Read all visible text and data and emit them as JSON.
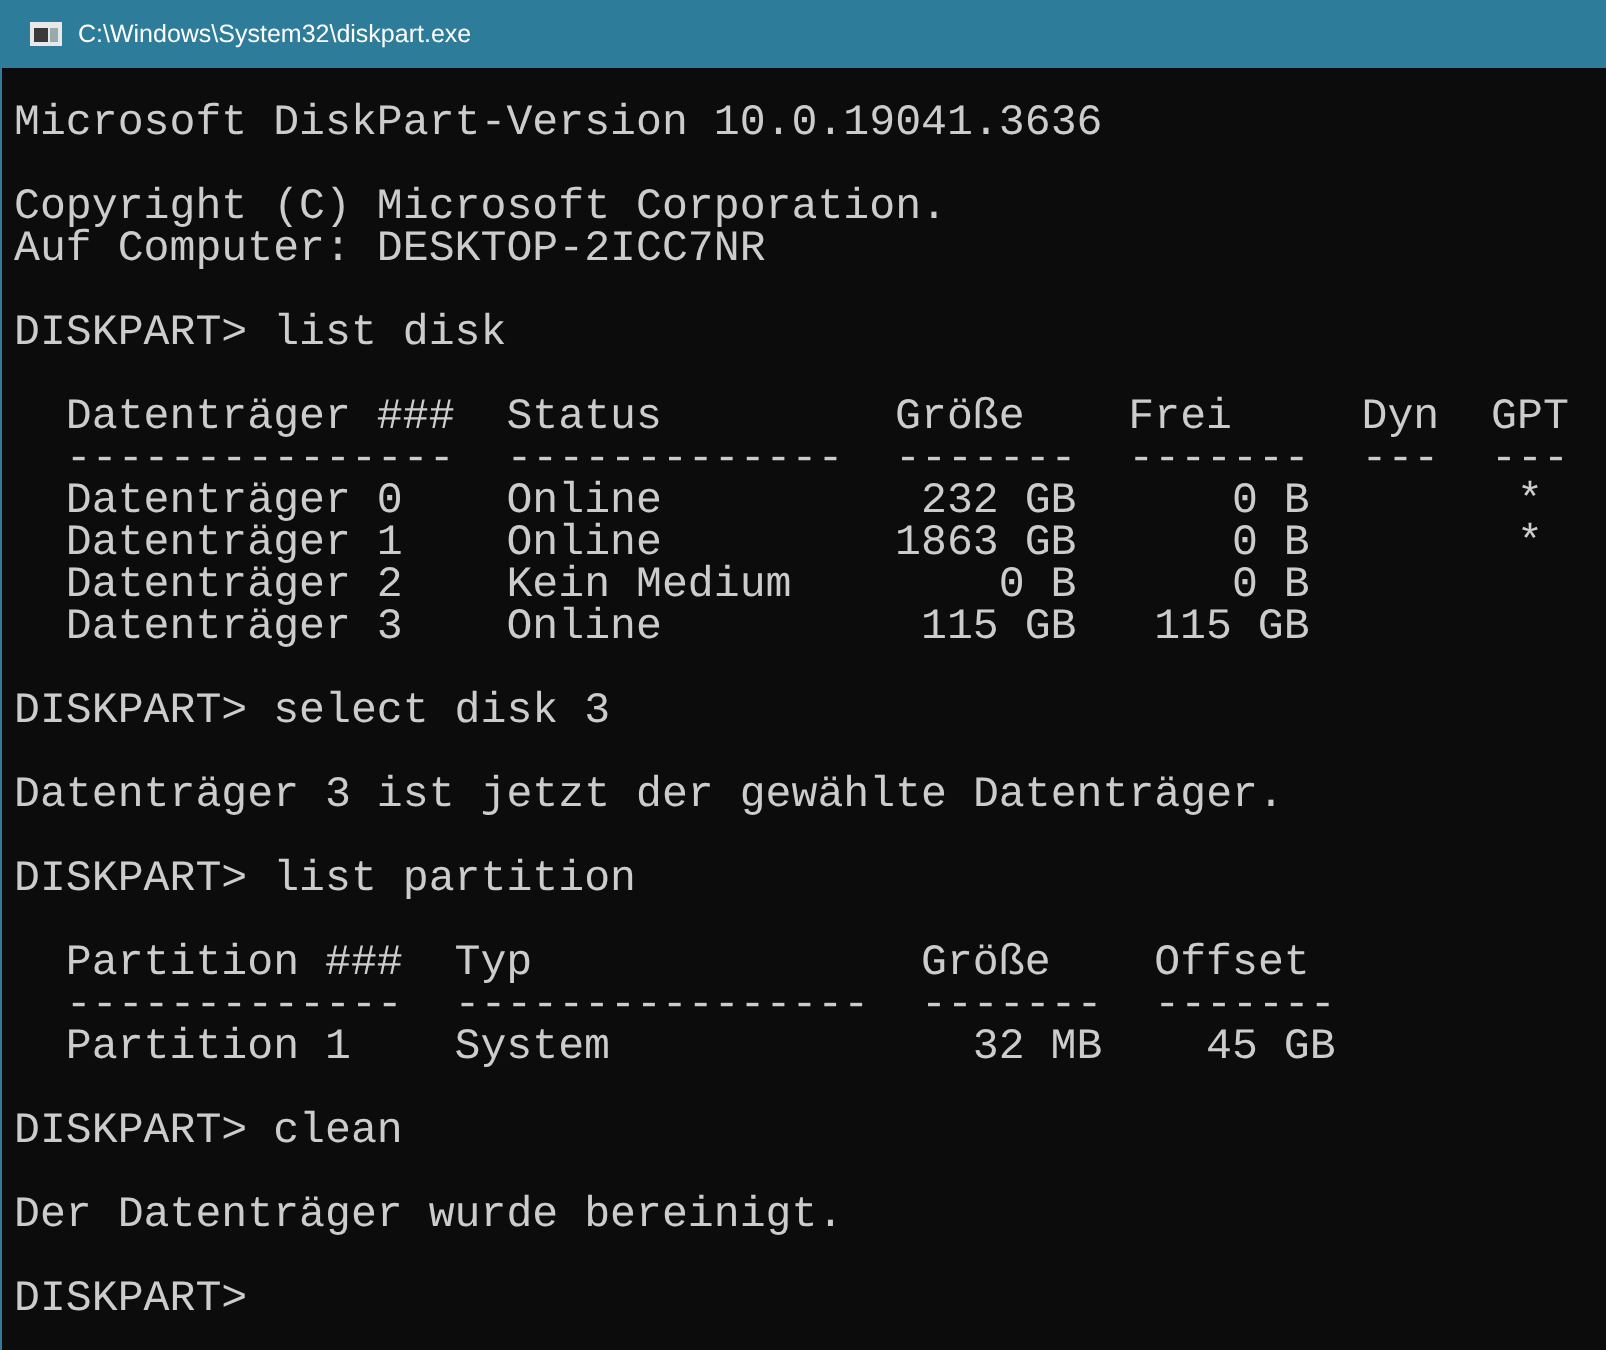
{
  "window": {
    "title": "C:\\Windows\\System32\\diskpart.exe"
  },
  "blocks": [
    {
      "kind": "lines",
      "lines": [
        "Microsoft DiskPart-Version 10.0.19041.3636"
      ]
    },
    {
      "kind": "lines",
      "lines": [
        "Copyright (C) Microsoft Corporation.",
        "Auf Computer: DESKTOP-2ICC7NR"
      ]
    },
    {
      "kind": "lines",
      "lines": [
        "DISKPART> list disk"
      ]
    },
    {
      "kind": "table",
      "columns": [
        {
          "header": "Datenträger ###",
          "rule": "---------------",
          "kind": "text"
        },
        {
          "header": "Status",
          "rule": "-------------",
          "kind": "text"
        },
        {
          "header": "Größe",
          "rule": "-------",
          "kind": "size"
        },
        {
          "header": "Frei",
          "rule": "-------",
          "kind": "size"
        },
        {
          "header": "Dyn",
          "rule": "---"
        },
        {
          "header": "GPT",
          "rule": "---",
          "kind": "flag"
        }
      ],
      "rows": [
        [
          "Datenträger 0",
          "Online",
          "232 GB",
          "0 B",
          null,
          "*"
        ],
        [
          "Datenträger 1",
          "Online",
          "1863 GB",
          "0 B",
          null,
          "*"
        ],
        [
          "Datenträger 2",
          "Kein Medium",
          "0 B",
          "0 B",
          null,
          null
        ],
        [
          "Datenträger 3",
          "Online",
          "115 GB",
          "115 GB",
          null,
          null
        ]
      ]
    },
    {
      "kind": "lines",
      "lines": [
        "DISKPART> select disk 3"
      ]
    },
    {
      "kind": "lines",
      "lines": [
        "Datenträger 3 ist jetzt der gewählte Datenträger."
      ]
    },
    {
      "kind": "lines",
      "lines": [
        "DISKPART> list partition"
      ]
    },
    {
      "kind": "table",
      "columns": [
        {
          "header": "Partition ###",
          "rule": "-------------",
          "kind": "text"
        },
        {
          "header": "Typ",
          "rule": "----------------",
          "kind": "text"
        },
        {
          "header": "Größe",
          "rule": "-------",
          "kind": "size"
        },
        {
          "header": "Offset",
          "rule": "-------",
          "kind": "size"
        }
      ],
      "rows": [
        [
          "Partition 1",
          "System",
          "32 MB",
          "45 GB"
        ]
      ]
    },
    {
      "kind": "lines",
      "lines": [
        "DISKPART> clean"
      ]
    },
    {
      "kind": "lines",
      "lines": [
        "Der Datenträger wurde bereinigt."
      ]
    },
    {
      "kind": "lines",
      "lines": [
        "DISKPART>"
      ]
    }
  ]
}
